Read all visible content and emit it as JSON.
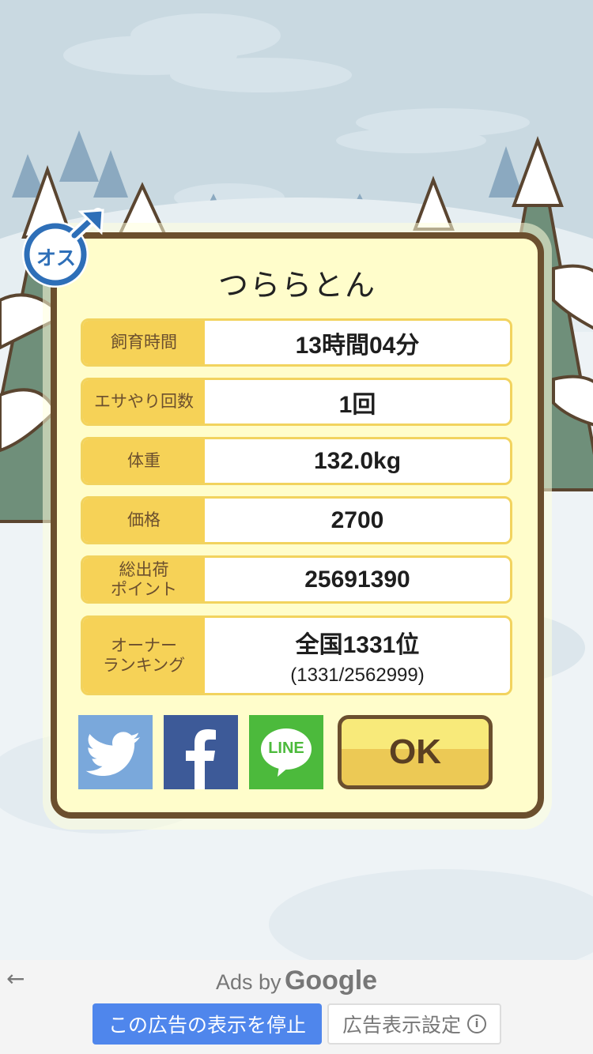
{
  "pet": {
    "name": "つららとん",
    "gender_icon": "male-icon",
    "gender_label": "オス"
  },
  "stats": [
    {
      "label": "飼育時間",
      "value": "13時間04分",
      "sub": ""
    },
    {
      "label": "エサやり回数",
      "value": "1回",
      "sub": ""
    },
    {
      "label": "体重",
      "value": "132.0kg",
      "sub": ""
    },
    {
      "label": "価格",
      "value": "2700",
      "sub": ""
    },
    {
      "label": "総出荷\nポイント",
      "value": "25691390",
      "sub": ""
    },
    {
      "label": "オーナー\nランキング",
      "value": "全国1331位",
      "sub": "(1331/2562999)"
    }
  ],
  "share": {
    "twitter_icon": "twitter-icon",
    "facebook_icon": "facebook-icon",
    "line_icon": "line-icon",
    "line_label": "LINE"
  },
  "ok_label": "OK",
  "ads": {
    "ads_by": "Ads by",
    "google": "Google",
    "stop_label": "この広告の表示を停止",
    "settings_label": "広告表示設定",
    "back_icon": "back-arrow-icon",
    "info_icon": "info-icon"
  },
  "colors": {
    "card_border": "#6b4f2e",
    "card_bg": "#fffdcb",
    "label_bg": "#f6d257",
    "twitter": "#7aa8db",
    "facebook": "#3d5a98",
    "line": "#4cba3c",
    "ad_button": "#4f86ec"
  }
}
